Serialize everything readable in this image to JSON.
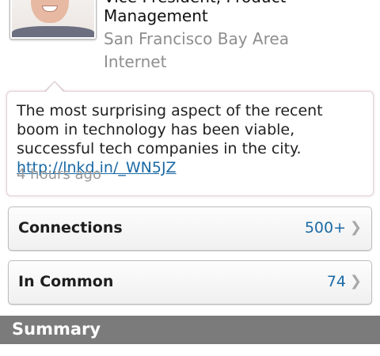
{
  "profile": {
    "title_cut": "Vice President, Product",
    "title_line": "Management",
    "location": "San Francisco Bay Area",
    "industry": "Internet"
  },
  "update": {
    "text": "The most surprising aspect of the recent boom in technology has been viable, successful tech companies in the city.",
    "link": "http://lnkd.in/_WN5JZ",
    "time": "4 hours ago"
  },
  "rows": [
    {
      "label": "Connections",
      "value": "500+",
      "chevron": "❯"
    },
    {
      "label": "In Common",
      "value": "74",
      "chevron": "❯"
    }
  ],
  "summary": {
    "title": "Summary"
  },
  "colors": {
    "link": "#1b6aa5",
    "summary_bar": "#7b7b7b",
    "muted_text": "#8e8e8e"
  },
  "icons": {
    "avatar": "profile-photo",
    "chevron": "chevron-right-icon"
  }
}
